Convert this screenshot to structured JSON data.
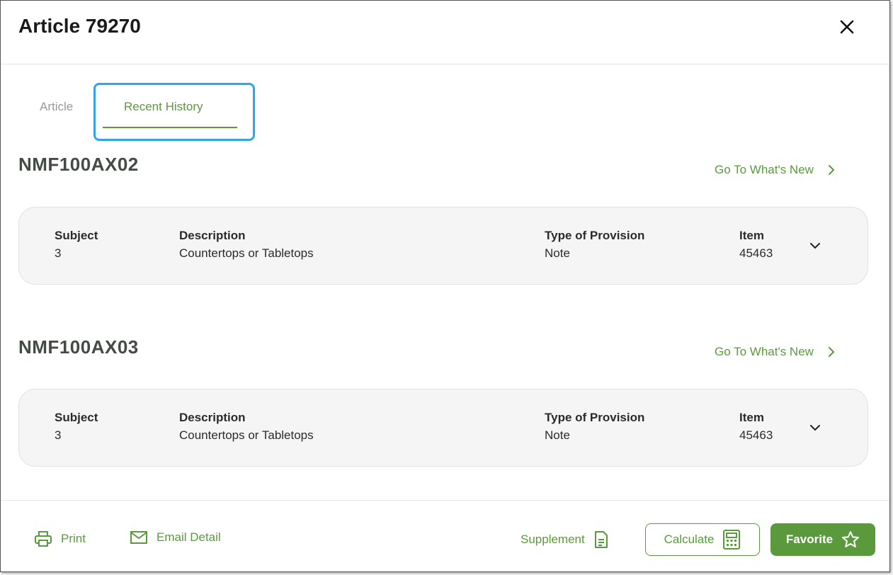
{
  "header": {
    "title": "Article 79270"
  },
  "tabs": [
    {
      "label": "Article",
      "active": false
    },
    {
      "label": "Recent History",
      "active": true
    }
  ],
  "sections": [
    {
      "title": "NMF100AX02",
      "link_label": "Go To What's New",
      "card": {
        "subject_label": "Subject",
        "subject_value": "3",
        "description_label": "Description",
        "description_value": "Countertops or Tabletops",
        "type_label": "Type of Provision",
        "type_value": "Note",
        "item_label": "Item",
        "item_value": "45463"
      }
    },
    {
      "title": "NMF100AX03",
      "link_label": "Go To What's New",
      "card": {
        "subject_label": "Subject",
        "subject_value": "3",
        "description_label": "Description",
        "description_value": "Countertops or Tabletops",
        "type_label": "Type of Provision",
        "type_value": "Note",
        "item_label": "Item",
        "item_value": "45463"
      }
    }
  ],
  "footer": {
    "print_label": "Print",
    "email_label": "Email Detail",
    "supplement_label": "Supplement",
    "calculate_label": "Calculate",
    "favorite_label": "Favorite"
  },
  "colors": {
    "accent": "#5a9a3c",
    "focus_ring": "#2ea6e8",
    "card_bg": "#f5f5f5"
  },
  "icons": [
    "close-icon",
    "chevron-right-icon",
    "chevron-down-icon",
    "printer-icon",
    "mail-icon",
    "document-icon",
    "calculator-icon",
    "star-icon"
  ]
}
